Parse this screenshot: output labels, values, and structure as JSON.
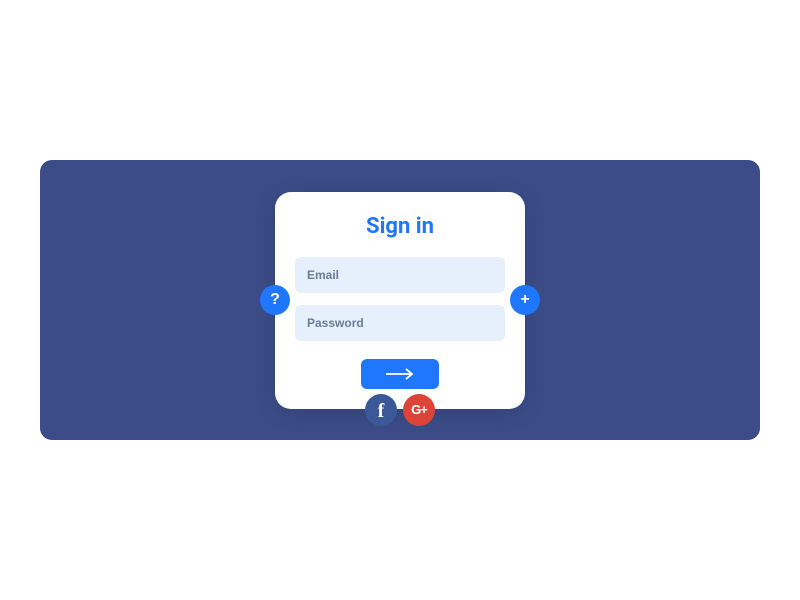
{
  "form": {
    "title": "Sign in",
    "email_placeholder": "Email",
    "password_placeholder": "Password"
  },
  "side_buttons": {
    "help_symbol": "?",
    "add_symbol": "+"
  },
  "social": {
    "facebook_symbol": "f",
    "google_symbol": "G+"
  },
  "colors": {
    "background": "#3b4c88",
    "primary": "#1f76ff",
    "input_bg": "#e6f0fc",
    "facebook": "#3b5998",
    "google": "#db4437"
  }
}
